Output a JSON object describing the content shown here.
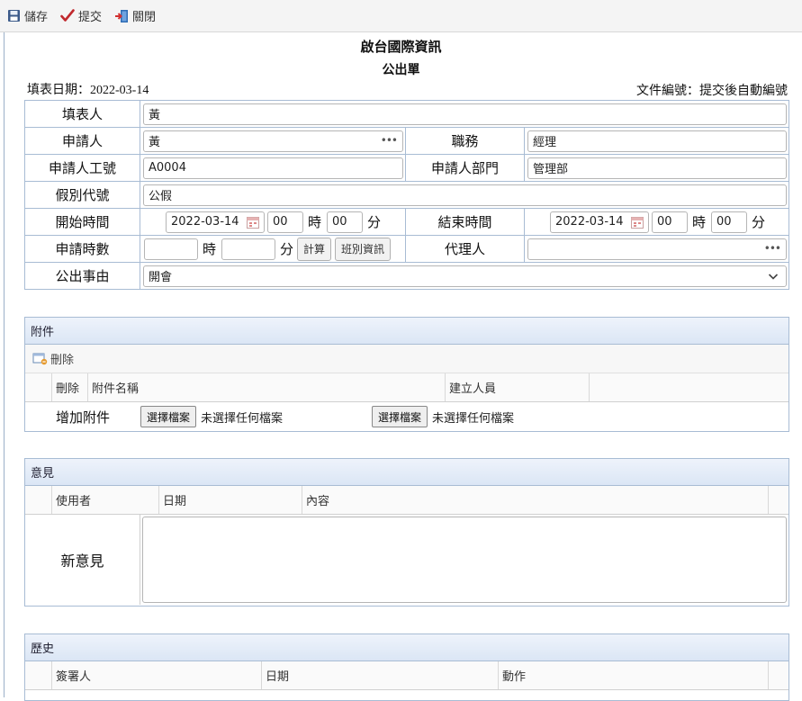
{
  "toolbar": {
    "save_label": "儲存",
    "submit_label": "提交",
    "close_label": "關閉"
  },
  "header": {
    "company": "啟台國際資訊",
    "form_name": "公出單",
    "fill_date": "填表日期：2022-03-14",
    "doc_no": "文件編號：提交後自動編號"
  },
  "form": {
    "filler_label": "填表人",
    "filler_value": "黃",
    "applicant_label": "申請人",
    "applicant_value": "黃",
    "position_label": "職務",
    "position_value": "經理",
    "emp_no_label": "申請人工號",
    "emp_no_value": "A0004",
    "dept_label": "申請人部門",
    "dept_value": "管理部",
    "leave_code_label": "假別代號",
    "leave_code_value": "公假",
    "start_label": "開始時間",
    "start_date": "2022-03-14",
    "start_hour": "00",
    "start_min": "00",
    "end_label": "結束時間",
    "end_date": "2022-03-14",
    "end_hour": "00",
    "end_min": "00",
    "hour_unit": "時",
    "min_unit": "分",
    "hours_label": "申請時數",
    "hours_value": "",
    "mins_value": "",
    "calc_button": "計算",
    "shift_button": "班別資訊",
    "agent_label": "代理人",
    "agent_value": "",
    "reason_label": "公出事由",
    "reason_value": "開會"
  },
  "attachments": {
    "title": "附件",
    "delete_label": "刪除",
    "columns": [
      "刪除",
      "附件名稱",
      "建立人員"
    ],
    "add_label": "增加附件",
    "choose_file": "選擇檔案",
    "no_file": "未選擇任何檔案"
  },
  "opinions": {
    "title": "意見",
    "columns": [
      "使用者",
      "日期",
      "內容"
    ],
    "new_label": "新意見"
  },
  "history": {
    "title": "歷史",
    "columns": [
      "簽署人",
      "日期",
      "動作"
    ]
  },
  "colors": {
    "border": "#a8bcd4",
    "panel_header": "#dbe6f5",
    "submit_check": "#c0282d"
  }
}
